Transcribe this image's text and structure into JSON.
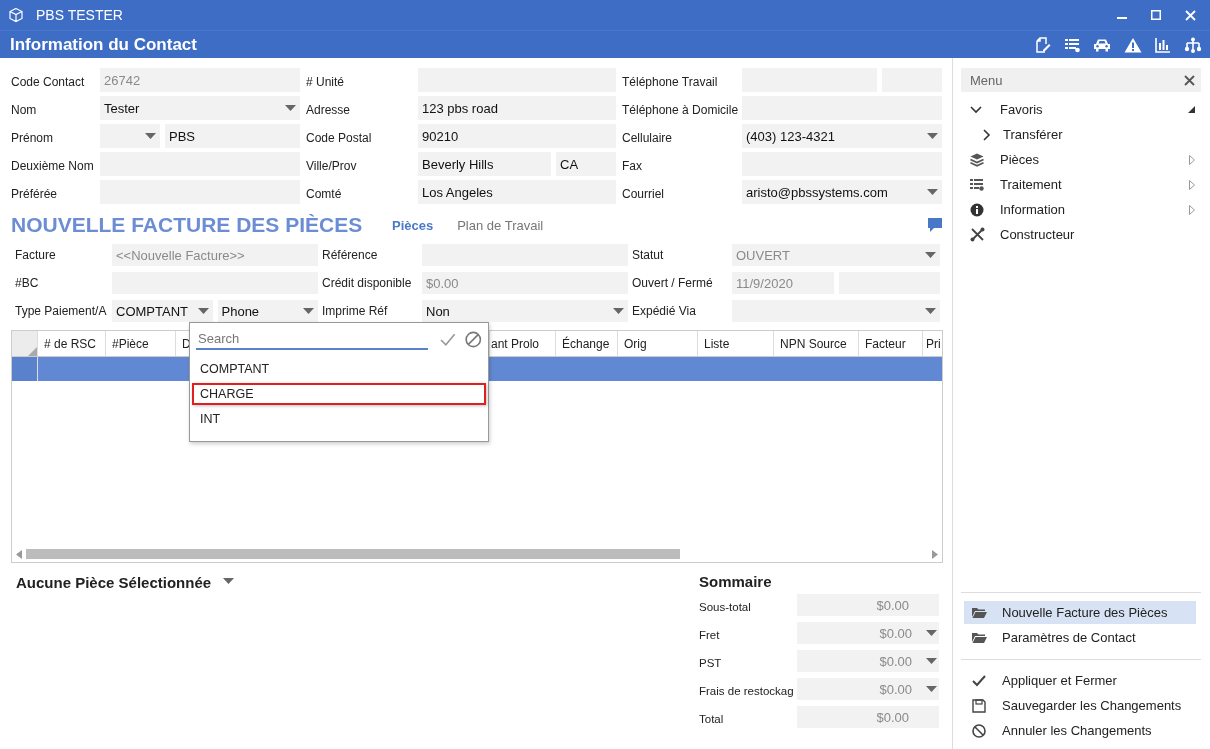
{
  "window": {
    "title": "PBS TESTER"
  },
  "header": {
    "title": "Information du Contact"
  },
  "contact": {
    "cells": [
      {
        "label": "Code Contact",
        "fields": [
          {
            "kind": "text",
            "value": "26742",
            "readonly": true,
            "short": false
          }
        ]
      },
      {
        "label": "# Unité",
        "fields": [
          {
            "kind": "text",
            "short": false
          }
        ]
      },
      {
        "label": "Téléphone Travail",
        "fields": [
          {
            "kind": "text",
            "short": false
          },
          {
            "kind": "text",
            "short": true
          }
        ]
      },
      {
        "label": "Nom",
        "fields": [
          {
            "kind": "select",
            "value": "Tester",
            "readonly": false,
            "short": false
          }
        ]
      },
      {
        "label": "Adresse",
        "fields": [
          {
            "kind": "text",
            "value": "123 pbs road",
            "readonly": false,
            "short": false
          }
        ]
      },
      {
        "label": "Téléphone à Domicile",
        "fields": [
          {
            "kind": "text",
            "short": false
          }
        ]
      },
      {
        "label": "Prénom",
        "fields": [
          {
            "kind": "select",
            "short": true
          },
          {
            "kind": "text",
            "value": "PBS",
            "readonly": false,
            "short": false
          }
        ]
      },
      {
        "label": "Code Postal",
        "fields": [
          {
            "kind": "text",
            "value": "90210",
            "readonly": false,
            "short": false
          }
        ]
      },
      {
        "label": "Cellulaire",
        "fields": [
          {
            "kind": "select",
            "value": "(403) 123-4321",
            "readonly": false,
            "short": false
          }
        ]
      },
      {
        "label": "Deuxième Nom",
        "fields": [
          {
            "kind": "text",
            "short": false
          }
        ]
      },
      {
        "label": "Ville/Prov",
        "fields": [
          {
            "kind": "text",
            "value": "Beverly Hills",
            "readonly": false,
            "short": false
          },
          {
            "kind": "text",
            "value": "CA",
            "readonly": false,
            "short": true
          }
        ]
      },
      {
        "label": "Fax",
        "fields": [
          {
            "kind": "text",
            "short": false
          }
        ]
      },
      {
        "label": "Préférée",
        "fields": [
          {
            "kind": "text",
            "short": false
          }
        ]
      },
      {
        "label": "Comté",
        "fields": [
          {
            "kind": "text",
            "value": "Los Angeles",
            "readonly": false,
            "short": false
          }
        ]
      },
      {
        "label": "Courriel",
        "fields": [
          {
            "kind": "select",
            "value": "aristo@pbssystems.com",
            "readonly": false,
            "short": false
          }
        ]
      }
    ]
  },
  "invoice": {
    "title": "NOUVELLE FACTURE DES PIÈCES",
    "tabs": [
      {
        "label": "Pièces",
        "selected": true
      },
      {
        "label": "Plan de Travail",
        "selected": false
      }
    ],
    "cells": [
      {
        "label": "Facture",
        "fields": [
          {
            "kind": "text",
            "value": "<<Nouvelle Facture>>",
            "readonly": true,
            "short": false
          }
        ]
      },
      {
        "label": "Référence",
        "fields": [
          {
            "kind": "text",
            "short": false
          }
        ]
      },
      {
        "label": "Statut",
        "fields": [
          {
            "kind": "select",
            "value": "OUVERT",
            "readonly": true,
            "short": false
          }
        ]
      },
      {
        "label": "#BC",
        "fields": [
          {
            "kind": "text",
            "short": false
          }
        ]
      },
      {
        "label": "Crédit disponible",
        "fields": [
          {
            "kind": "text",
            "value": "$0.00",
            "readonly": true,
            "short": false
          }
        ]
      },
      {
        "label": "Ouvert / Fermé",
        "fields": [
          {
            "kind": "text",
            "value": "11/9/2020",
            "readonly": true,
            "short": false
          },
          {
            "kind": "text",
            "short": false
          }
        ]
      },
      {
        "label": "Type Paiement/A",
        "fields": [
          {
            "kind": "select",
            "value": "COMPTANT",
            "readonly": false,
            "short": false
          },
          {
            "kind": "select",
            "value": "Phone",
            "readonly": false,
            "short": false
          }
        ]
      },
      {
        "label": "Imprime Réf",
        "fields": [
          {
            "kind": "select",
            "value": "Non",
            "readonly": false,
            "short": false
          }
        ]
      },
      {
        "label": "Expédié Via",
        "fields": [
          {
            "kind": "select",
            "short": false
          }
        ]
      }
    ]
  },
  "table": {
    "columns": [
      "# de RSC",
      "#Pièce",
      "D",
      "ant Prolo",
      "Échange",
      "Orig",
      "Liste",
      "NPN Source",
      "Facteur",
      "Pri"
    ],
    "rows": [
      {
        "selected": true
      }
    ]
  },
  "dropdown_list": {
    "search": {
      "placeholder": "Search"
    },
    "options": [
      {
        "label": "COMPTANT",
        "highlighted": false
      },
      {
        "label": "CHARGE",
        "highlighted": true
      },
      {
        "label": "INT",
        "highlighted": false
      }
    ]
  },
  "part_selector": {
    "label": "Aucune Pièce Sélectionnée"
  },
  "summary": {
    "title": "Sommaire",
    "rows": [
      {
        "label": "Sous-total",
        "value": "$0.00",
        "dropdown": false
      },
      {
        "label": "Fret",
        "value": "$0.00",
        "dropdown": true
      },
      {
        "label": "PST",
        "value": "$0.00",
        "dropdown": true
      },
      {
        "label": "Frais de restockag",
        "value": "$0.00",
        "dropdown": true
      },
      {
        "label": "Total",
        "value": "$0.00",
        "dropdown": false
      }
    ]
  },
  "menu": {
    "title": "Menu",
    "items": [
      {
        "label": "Favoris",
        "expanded": true,
        "children": [
          {
            "label": "Transférer"
          }
        ]
      },
      {
        "label": "Pièces",
        "submenu": true
      },
      {
        "label": "Traitement",
        "submenu": true
      },
      {
        "label": "Information",
        "submenu": true
      },
      {
        "label": "Constructeur",
        "submenu": false
      }
    ]
  },
  "menu_links": [
    {
      "label": "Nouvelle Facture des Pièces",
      "selected": true
    },
    {
      "label": "Paramètres de Contact",
      "selected": false
    }
  ],
  "menu_actions": [
    "Appliquer et Fermer",
    "Sauvegarder les Changements",
    "Annuler les Changements"
  ]
}
